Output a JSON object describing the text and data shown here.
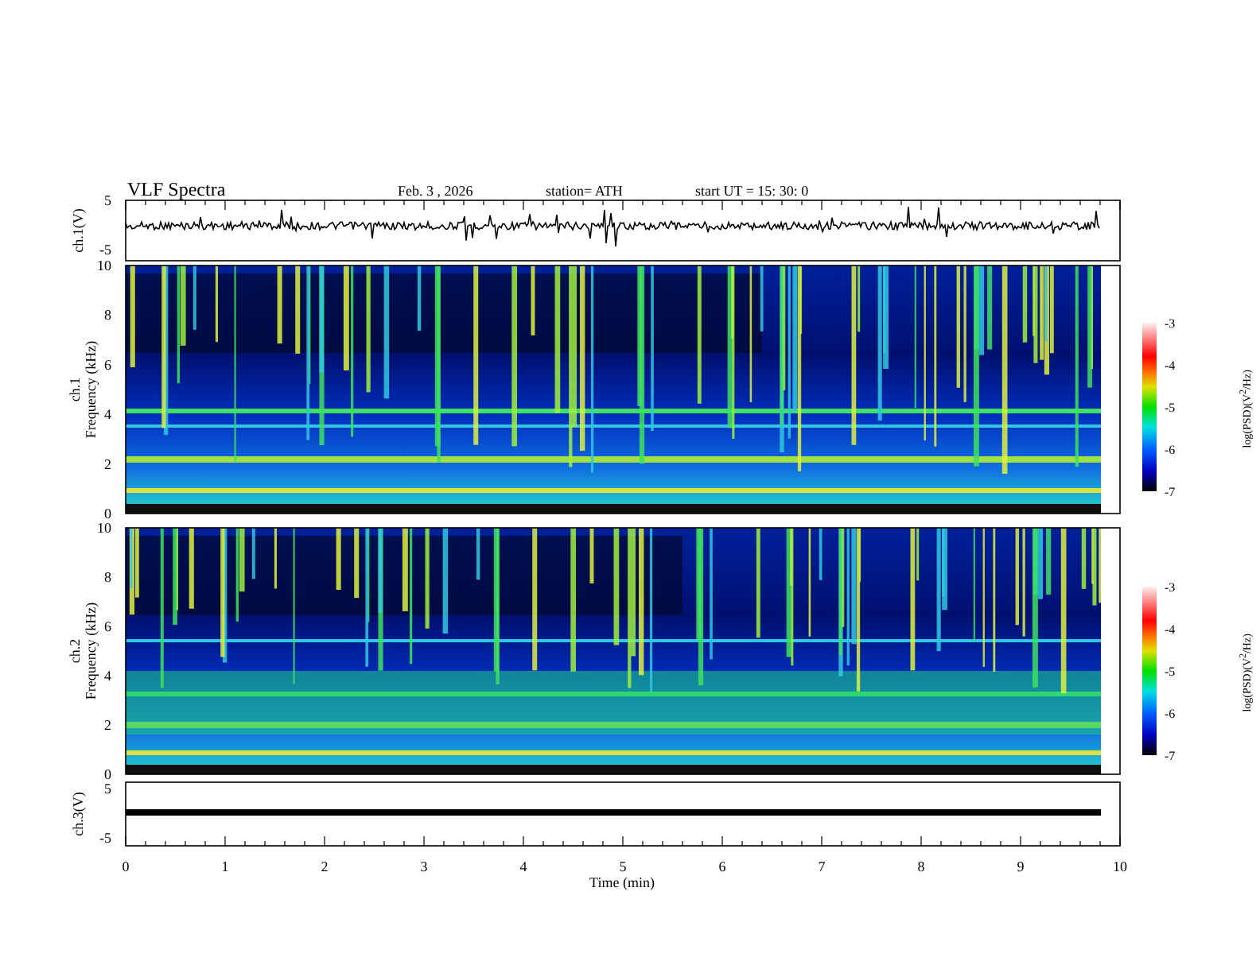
{
  "header": {
    "title": "VLF  Spectra",
    "date": "Feb. 3  , 2026",
    "station": "station= ATH",
    "start": "start  UT  =    15: 30: 0"
  },
  "ch1": {
    "ylabel": "ch.1(V)",
    "yticks": [
      "5",
      "-5"
    ]
  },
  "spectrograms": [
    {
      "ylabel": "ch.1",
      "ylabel2": "Frequency  (kHz)",
      "yticks": [
        "10",
        "8",
        "6",
        "4",
        "2",
        "0"
      ],
      "colorbar_label": "log(PSD)(V$^{2}$/Hz)",
      "colorbar_ticks": [
        "-3",
        "-4",
        "-5",
        "-6",
        "-7"
      ]
    },
    {
      "ylabel": "ch.2",
      "ylabel2": "Frequency  (kHz)",
      "yticks": [
        "10",
        "8",
        "6",
        "4",
        "2",
        "0"
      ],
      "colorbar_label": "log(PSD)(V$^{2}$/Hz)",
      "colorbar_ticks": [
        "-3",
        "-4",
        "-5",
        "-6",
        "-7"
      ]
    }
  ],
  "ch3": {
    "ylabel": "ch.3(V)",
    "yticks": [
      "5",
      "-5"
    ]
  },
  "xaxis": {
    "label": "Time  (min)",
    "ticks": [
      "0",
      "1",
      "2",
      "3",
      "4",
      "5",
      "6",
      "7",
      "8",
      "9",
      "10"
    ]
  }
}
